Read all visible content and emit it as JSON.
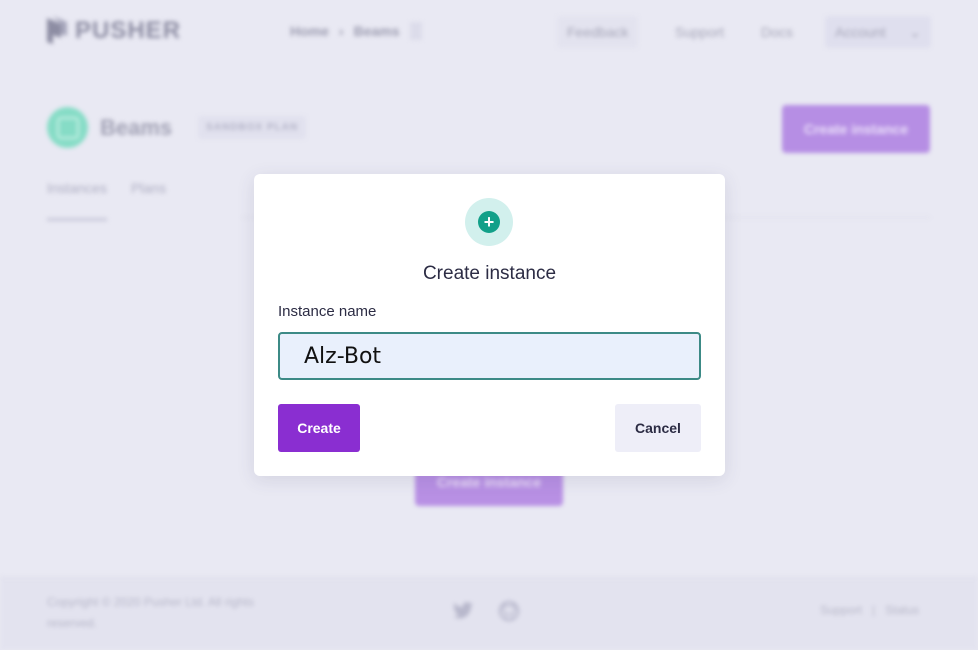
{
  "brand": {
    "name": "PUSHER"
  },
  "breadcrumb": {
    "home": "Home",
    "separator": "›",
    "current": "Beams"
  },
  "topnav": {
    "feedback": "Feedback",
    "support": "Support",
    "docs": "Docs",
    "account": "Account",
    "account_chevron": "⌄"
  },
  "product": {
    "title": "Beams",
    "plan_badge": "SANDBOX PLAN",
    "create_button": "Create instance"
  },
  "tabs": [
    {
      "label": "Instances",
      "active": true
    },
    {
      "label": "Plans",
      "active": false
    }
  ],
  "main": {
    "create_button": "Create instance"
  },
  "footer": {
    "copyright": "Copyright © 2020 Pusher Ltd. All rights reserved.",
    "support": "Support",
    "divider": "|",
    "status": "Status",
    "icons": [
      "twitter-icon",
      "github-icon"
    ]
  },
  "modal": {
    "icon": "plus-icon",
    "icon_glyph": "+",
    "title": "Create instance",
    "field_label": "Instance name",
    "input_value": "Alz-Bot",
    "create_label": "Create",
    "cancel_label": "Cancel"
  },
  "colors": {
    "accent": "#8a2ed1",
    "teal": "#12a089",
    "background": "#e9e9f3"
  }
}
